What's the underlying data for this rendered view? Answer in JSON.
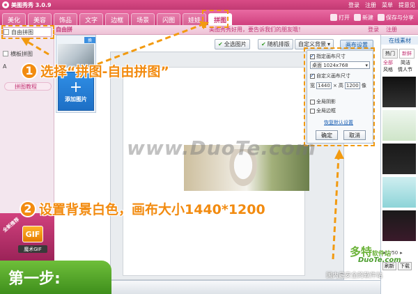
{
  "app": {
    "title": "美图秀秀 3.0.9",
    "header_links": [
      "登录",
      "注册",
      "菜单",
      "提意见"
    ]
  },
  "tabs": [
    {
      "label": "美化",
      "active": false
    },
    {
      "label": "美容",
      "active": false
    },
    {
      "label": "饰品",
      "active": false
    },
    {
      "label": "文字",
      "active": false
    },
    {
      "label": "边框",
      "active": false
    },
    {
      "label": "场景",
      "active": false
    },
    {
      "label": "闪图",
      "active": false
    },
    {
      "label": "娃娃",
      "active": false
    },
    {
      "label": "拼图",
      "active": true
    }
  ],
  "toolbar": {
    "open_label": "打开",
    "new_label": "新建",
    "save_label": "保存与分享"
  },
  "subbar": {
    "title": "自由拼",
    "tip": "美图秀秀好用，要告诉我们的朋友哦！",
    "right_links": [
      "登录",
      "注册"
    ]
  },
  "sidebar": {
    "items": [
      {
        "label": "自由拼图",
        "selected": true
      },
      {
        "label": "横板拼图",
        "selected": false
      },
      {
        "label": "A",
        "selected": false
      }
    ],
    "tutorial": "拼图教程"
  },
  "gif_promo": {
    "badge": "GIF",
    "label": "魔术GIF",
    "ribbon": "全新推荐"
  },
  "thumbs": {
    "replace_tag": "换",
    "add_label": "添加图片"
  },
  "canvas_toolbar": {
    "fullscreen": "全选图片",
    "random": "随机排版",
    "custom_bg": "自定义背景",
    "canvas_settings": "画布设置"
  },
  "canvas_settings": {
    "fixed_size_label": "指定画布尺寸",
    "preset_value": "桌面 1024x768",
    "custom_size_label": "自定义画布尺寸",
    "width_label": "宽",
    "width_value": "1440",
    "height_label": "高",
    "height_value": "1200",
    "unit": "像",
    "multiply": "×",
    "shadow_label": "全局阴影",
    "border_label": "全局边框",
    "default_link": "恢复默认设置",
    "ok_label": "确定",
    "cancel_label": "取消"
  },
  "right_panel": {
    "header": "在线素材",
    "tabs": [
      "热门",
      "新鲜"
    ],
    "filters": [
      "全部",
      "风格",
      "简洁",
      "情人节"
    ],
    "pager": "1/50",
    "buttons": [
      "刷新",
      "下载"
    ]
  },
  "annotations": {
    "step1_num": "1",
    "step1_text": "选择“拼图-自由拼图”",
    "step2_num": "2",
    "step2_text": "设置背景白色，画布大小1440*1200",
    "first_step": "第一步:"
  },
  "watermark": "www.DuoTe.com",
  "site_logo": {
    "cn": "多特",
    "cn_small": "软件站",
    "en": "DuoTe.com",
    "slogan": "国内最安全的软件站"
  }
}
